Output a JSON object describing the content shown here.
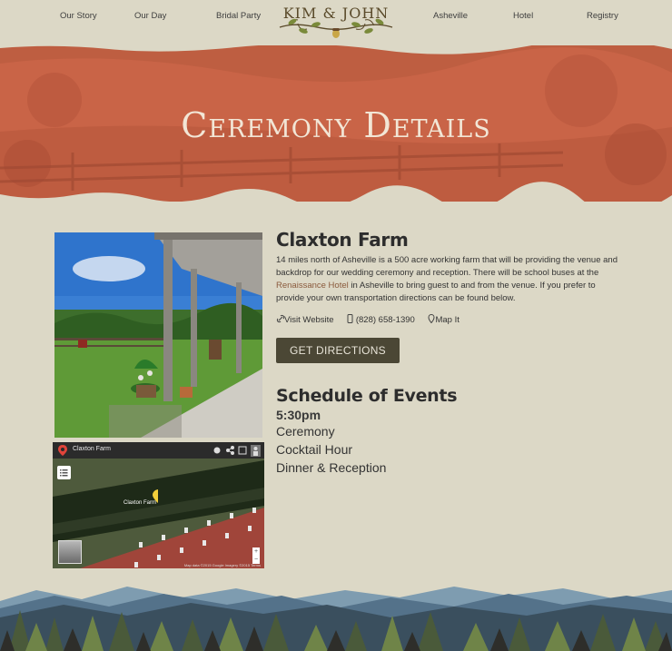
{
  "nav": {
    "items": [
      "Our Story",
      "Our Day",
      "Bridal Party",
      "Asheville",
      "Hotel",
      "Registry"
    ],
    "logo": "KIM & JOHN"
  },
  "hero": {
    "title": "Ceremony Details"
  },
  "venue": {
    "name": "Claxton Farm",
    "desc_before": "14 miles north of Asheville is a 500 acre working farm that will be providing the venue and backdrop for our wedding ceremony and reception. There will be school buses at the ",
    "desc_link": "Renaissance Hotel",
    "desc_after": " in Asheville to bring guest to and from the venue. If you prefer to provide your own transportation directions can be found below.",
    "website": "Visit Website",
    "phone": "(828) 658-1390",
    "map_it": "Map It",
    "button": "GET DIRECTIONS"
  },
  "map": {
    "title": "Claxton Farm",
    "pin_label": "Claxton Farm",
    "footer": "Map data ©2015 Google Imagery ©2015   Terms"
  },
  "schedule": {
    "heading": "Schedule of Events",
    "time": "5:30pm",
    "events": [
      "Ceremony",
      "Cocktail Hour",
      "Dinner & Reception"
    ]
  },
  "colors": {
    "background": "#dcd8c6",
    "hero": "#c96447",
    "button": "#4b4735"
  }
}
